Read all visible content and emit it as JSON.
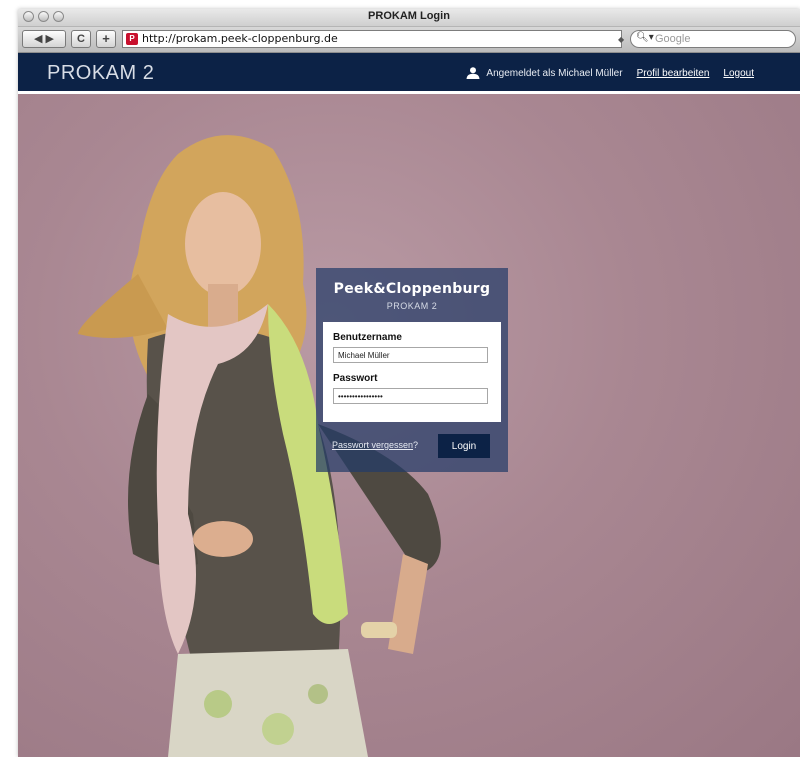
{
  "browser": {
    "window_title": "PROKAM Login",
    "back_label": "◀ ▶",
    "reload_label": "C",
    "add_label": "+",
    "url": "http://prokam.peek-cloppenburg.de",
    "search_placeholder": "Google"
  },
  "header": {
    "logo": "PROKAM 2",
    "logged_in_text": "Angemeldet als Michael Müller",
    "profile_link": "Profil bearbeiten",
    "logout_link": "Logout"
  },
  "login": {
    "brand": "Peek&Cloppenburg",
    "brand_sub": "PROKAM 2",
    "username_label": "Benutzername",
    "username_value": "Michael Müller",
    "password_label": "Passwort",
    "password_value": "••••••••••••••••",
    "forgot_link": "Passwort vergessen",
    "forgot_suffix": "?",
    "login_button": "Login"
  },
  "colors": {
    "header_bg": "#0c2246",
    "panel_bg": "#243c68",
    "hero_bg": "#a98792"
  }
}
